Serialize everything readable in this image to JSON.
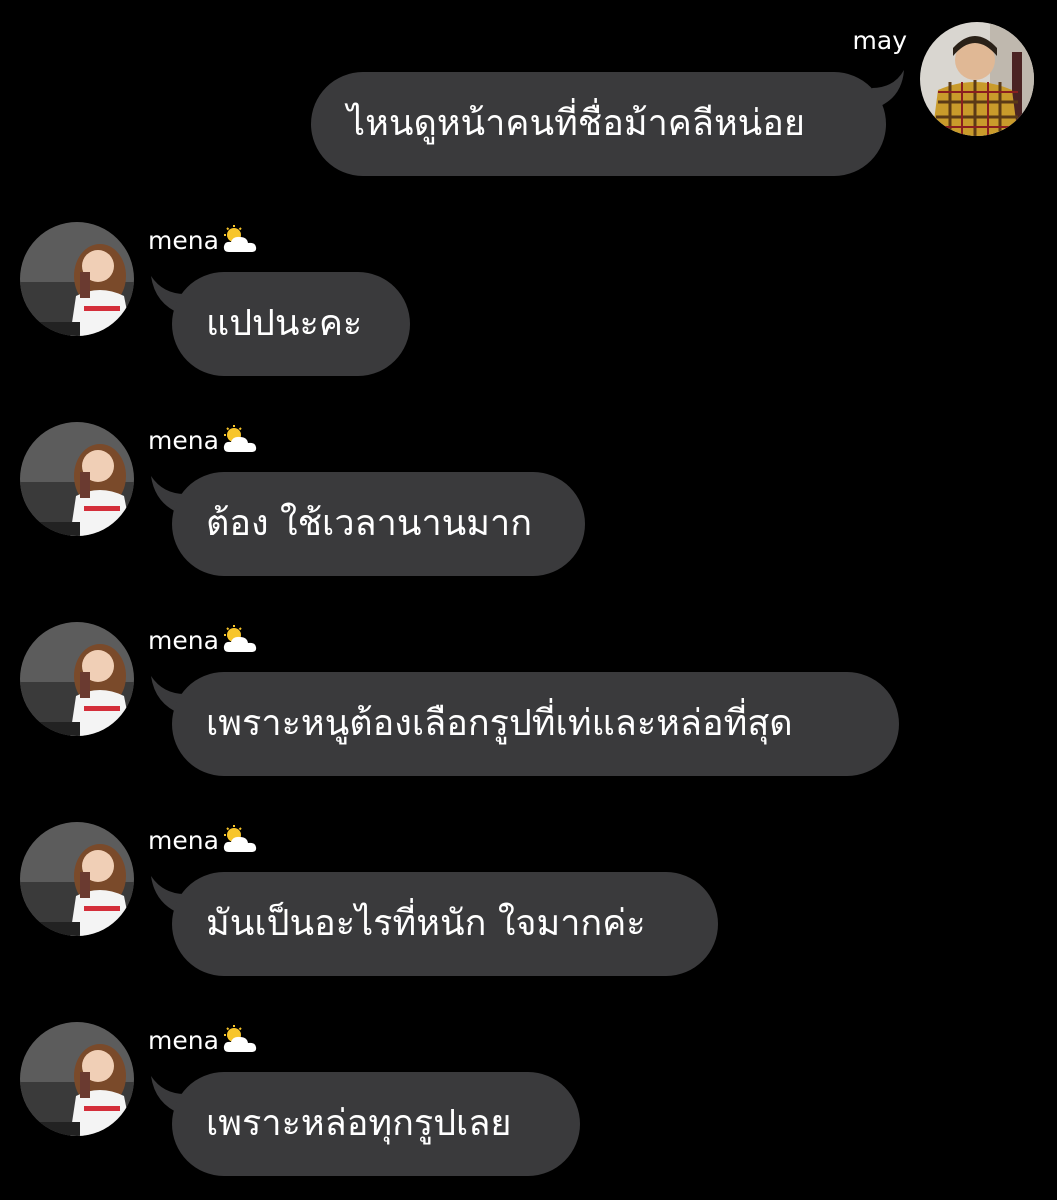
{
  "colors": {
    "background": "#000000",
    "bubble": "#3a3a3c",
    "text": "#ffffff"
  },
  "outgoing": {
    "sender": "may",
    "avatar_icon": "avatar-may",
    "text": "ไหนดูหน้าคนที่ชื่อม้าคลีหน่อย"
  },
  "incoming": [
    {
      "sender": "mena",
      "status_icon": "sun-behind-cloud-icon",
      "text": "แปปนะคะ"
    },
    {
      "sender": "mena",
      "status_icon": "sun-behind-cloud-icon",
      "text": "ต้อง ใช้เวลานานมาก"
    },
    {
      "sender": "mena",
      "status_icon": "sun-behind-cloud-icon",
      "text": "เพราะหนูต้องเลือกรูปที่เท่และหล่อที่สุด"
    },
    {
      "sender": "mena",
      "status_icon": "sun-behind-cloud-icon",
      "text": "มันเป็นอะไรที่หนัก ใจมากค่ะ"
    },
    {
      "sender": "mena",
      "status_icon": "sun-behind-cloud-icon",
      "text": "เพราะหล่อทุกรูปเลย"
    }
  ]
}
